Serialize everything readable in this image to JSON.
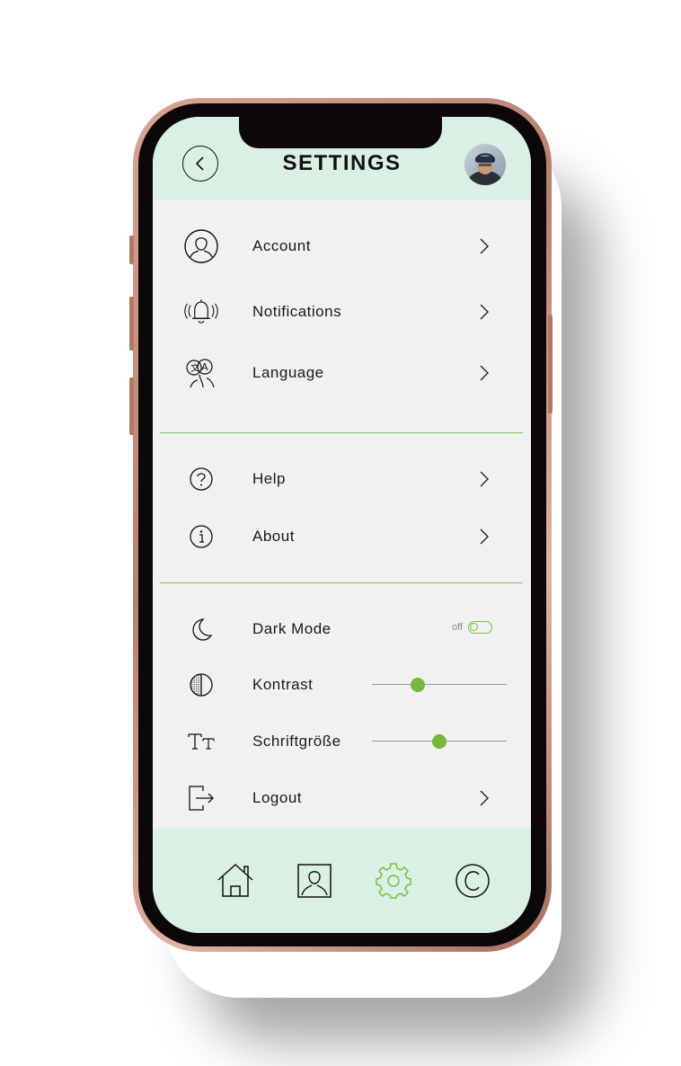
{
  "header": {
    "title": "SETTINGS",
    "back_icon": "chevron-left-circle-icon",
    "avatar_icon": "user-avatar"
  },
  "section_general": [
    {
      "label": "Account",
      "icon": "user-circle-icon"
    },
    {
      "label": "Notifications",
      "icon": "bell-ringing-icon"
    },
    {
      "label": "Language",
      "icon": "translate-icon"
    }
  ],
  "section_info": [
    {
      "label": "Help",
      "icon": "question-circle-icon"
    },
    {
      "label": "About",
      "icon": "info-circle-icon"
    }
  ],
  "section_display": {
    "dark_mode": {
      "label": "Dark Mode",
      "state_text": "off",
      "enabled": false
    },
    "contrast": {
      "label": "Kontrast",
      "value_fraction": 0.34
    },
    "font_size": {
      "label": "Schriftgröße",
      "value_fraction": 0.5
    },
    "logout": {
      "label": "Logout"
    }
  },
  "bottom_nav": [
    {
      "icon": "home-icon",
      "active": false
    },
    {
      "icon": "profile-icon",
      "active": false
    },
    {
      "icon": "gear-icon",
      "active": true
    },
    {
      "icon": "copyright-icon",
      "active": false
    }
  ],
  "colors": {
    "accent": "#7cbf3f",
    "header_bg": "#daf0e5",
    "screen_bg": "#f1f1f1",
    "frame": "#c8917f"
  }
}
